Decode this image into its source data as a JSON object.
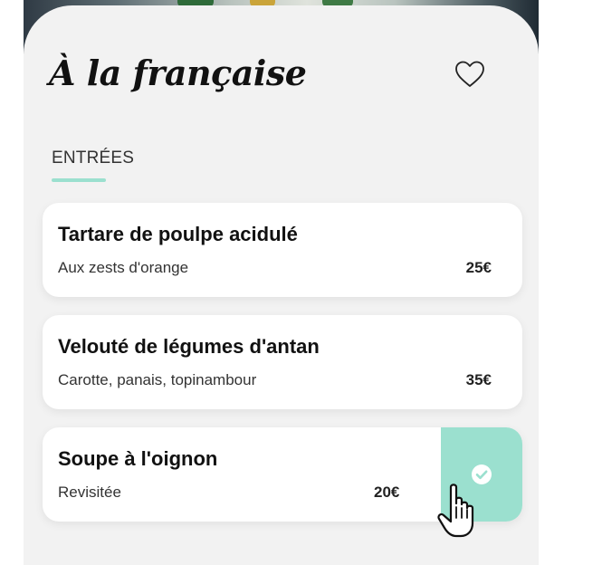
{
  "restaurant": {
    "title": "À la française"
  },
  "section": {
    "label": "ENTRÉES"
  },
  "dishes": [
    {
      "name": "Tartare de poulpe acidulé",
      "description": "Aux zests d'orange",
      "price": "25€"
    },
    {
      "name": "Velouté de légumes d'antan",
      "description": "Carotte, panais, topinambour",
      "price": "35€"
    },
    {
      "name": "Soupe à l'oignon",
      "description": "Revisitée",
      "price": "20€",
      "selected": true
    }
  ],
  "colors": {
    "accent": "#9be0cf",
    "background": "#f2f2f2",
    "card": "#ffffff"
  },
  "icons": {
    "favorite": "heart-outline-icon",
    "confirm": "check-circle-icon",
    "cursor": "hand-pointer-icon"
  }
}
